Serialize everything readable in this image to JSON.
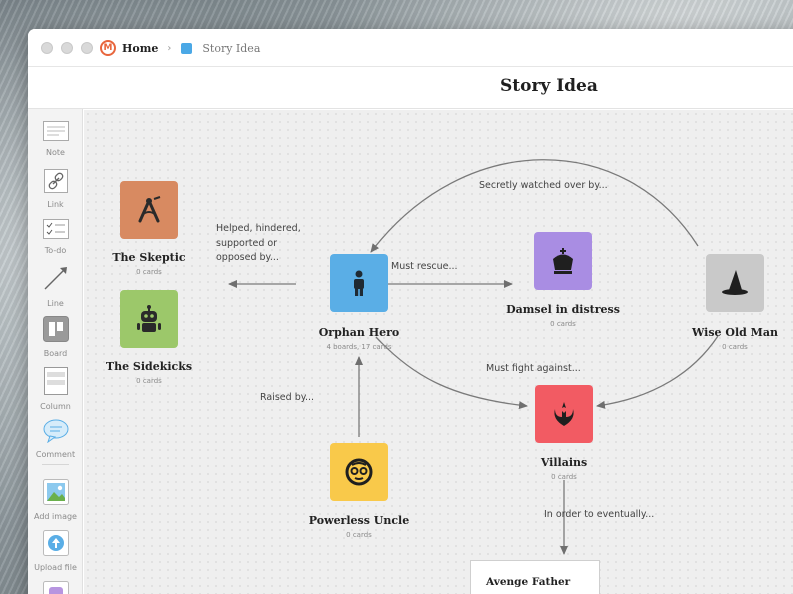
{
  "window": {
    "breadcrumb": {
      "home": "Home",
      "separator": "›",
      "board": "Story Idea"
    }
  },
  "header": {
    "title": "Story Idea"
  },
  "toolbar": {
    "items": [
      {
        "label": "Note"
      },
      {
        "label": "Link"
      },
      {
        "label": "To-do"
      },
      {
        "label": "Line"
      },
      {
        "label": "Board"
      },
      {
        "label": "Column"
      },
      {
        "label": "Comment"
      },
      {
        "label": "Add image"
      },
      {
        "label": "Upload file"
      }
    ]
  },
  "nodes": {
    "skeptic": {
      "title": "The Skeptic",
      "sub": "0 cards",
      "color": "#d88a61",
      "icon": "compass-icon"
    },
    "sidekicks": {
      "title": "The Sidekicks",
      "sub": "0 cards",
      "color": "#9cc86a",
      "icon": "robot-icon"
    },
    "orphan": {
      "title": "Orphan Hero",
      "sub": "4 boards, 17 cards",
      "color": "#5aaee6",
      "icon": "person-icon"
    },
    "damsel": {
      "title": "Damsel in distress",
      "sub": "0 cards",
      "color": "#a98de3",
      "icon": "crown-icon"
    },
    "wise": {
      "title": "Wise Old Man",
      "sub": "0 cards",
      "color": "#c9c9c9",
      "icon": "wizard-hat-icon"
    },
    "villains": {
      "title": "Villains",
      "sub": "0 cards",
      "color": "#f25b63",
      "icon": "rebel-emblem-icon"
    },
    "uncle": {
      "title": "Powerless Uncle",
      "sub": "0 cards",
      "color": "#f9c94a",
      "icon": "face-icon"
    }
  },
  "edges": {
    "secretly": "Secretly watched over by...",
    "helped_1": "Helped, hindered,",
    "helped_2": "supported or",
    "helped_3": "opposed by...",
    "rescue": "Must rescue...",
    "fight": "Must fight against...",
    "raised": "Raised by...",
    "eventually": "In order to eventually..."
  },
  "note": {
    "text": "Avenge Father"
  }
}
